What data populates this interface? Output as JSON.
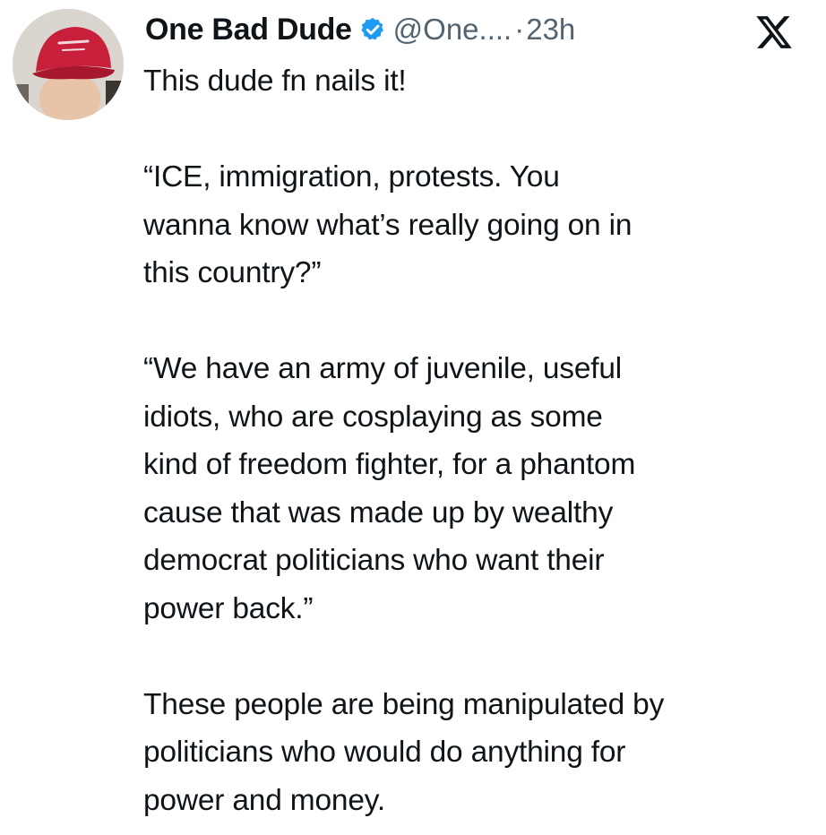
{
  "tweet": {
    "author": {
      "display_name": "One Bad Dude",
      "handle": "@One....",
      "verified": true,
      "verified_icon": "verified-badge-icon",
      "avatar": "profile-avatar-red-cap"
    },
    "separator": "·",
    "time": "23h",
    "platform_icon": "x-logo-icon",
    "colors": {
      "text": "#0f1419",
      "secondary": "#536471",
      "verified": "#1d9bf0"
    },
    "body": {
      "intro": "This dude fn nails it!",
      "quote1": [
        "“ICE, immigration, protests.  You",
        "wanna know what’s really going on in",
        "this country?”"
      ],
      "quote2": [
        "“We have an army of juvenile, useful",
        "idiots, who are cosplaying as some",
        "kind of freedom fighter, for a phantom",
        "cause that was made up by wealthy",
        "democrat politicians who want their",
        "power back.”"
      ],
      "closing": [
        "These people are being manipulated by",
        "politicians who would do anything for",
        "power and money."
      ]
    }
  }
}
